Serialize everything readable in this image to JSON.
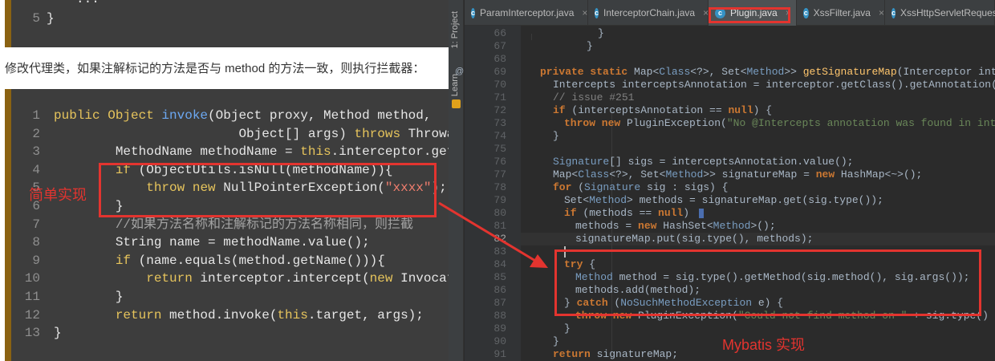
{
  "article": {
    "top_snippet": {
      "dots": "...",
      "line_number": "5",
      "closing": "}"
    },
    "paragraph": "修改代理类，如果注解标记的方法是否与 method 的方法一致，则执行拦截器：",
    "line_numbers": [
      "1",
      "2",
      "3",
      "4",
      "5",
      "6",
      "7",
      "8",
      "9",
      "10",
      "11",
      "12",
      "13"
    ],
    "code": {
      "l1_a": "public Object ",
      "l1_b": "invoke",
      "l1_c": "(Object proxy, Method method,",
      "l2_a": "                        Object[] args) ",
      "l2_b": "throws",
      "l2_c": " Throwabl",
      "l3_a": "        MethodName methodName = ",
      "l3_b": "this",
      "l3_c": ".interceptor.getCla",
      "l4_a": "        ",
      "l4_b": "if",
      "l4_c": " (ObjectUtils.isNull(methodName)){",
      "l5_a": "            ",
      "l5_b": "throw",
      "l5_c": " ",
      "l5_d": "new",
      "l5_e": " NullPointerException(",
      "l5_f": "\"xxxx\"",
      "l5_g": ");",
      "l6": "        }",
      "l7": "        //如果方法名称和注解标记的方法名称相同，则拦截",
      "l8": "        String name = methodName.value();",
      "l9_a": "        ",
      "l9_b": "if",
      "l9_c": " (name.equals(method.getName())){",
      "l10_a": "            ",
      "l10_b": "return",
      "l10_c": " interceptor.intercept(",
      "l10_d": "new",
      "l10_e": " Invocation",
      "l11": "        }",
      "l12_a": "        ",
      "l12_b": "return",
      "l12_c": " method.invoke(",
      "l12_d": "this",
      "l12_e": ".target, args);",
      "l13": "}"
    },
    "simple_impl_label": "简单实现"
  },
  "ide": {
    "side_tabs": {
      "project": "1: Project",
      "learn": "Learn"
    },
    "tabs": [
      {
        "label": "ParamInterceptor.java",
        "icon": "class-icon",
        "active": false
      },
      {
        "label": "InterceptorChain.java",
        "icon": "class-icon",
        "active": false
      },
      {
        "label": "Plugin.java",
        "icon": "class-icon",
        "active": true
      },
      {
        "label": "XssFilter.java",
        "icon": "class-icon",
        "active": false
      },
      {
        "label": "XssHttpServletRequestW",
        "icon": "class-icon",
        "active": false
      }
    ],
    "icon_letter": "c",
    "close_glyph": "×",
    "gutter_at": "@",
    "line_numbers": [
      "66",
      "67",
      "68",
      "69",
      "70",
      "71",
      "72",
      "73",
      "74",
      "75",
      "76",
      "77",
      "78",
      "79",
      "80",
      "81",
      "82",
      "83",
      "84",
      "85",
      "86",
      "87",
      "88",
      "89",
      "90",
      "91"
    ],
    "code": {
      "l69_a": "private static ",
      "l69_b": "Map",
      "l69_c": "<",
      "l69_d": "Class",
      "l69_e": "<?>",
      "l69_f": ", ",
      "l69_g": "Set",
      "l69_h": "<",
      "l69_i": "Method",
      "l69_j": ">> ",
      "l69_k": "getSignatureMap",
      "l69_l": "(Interceptor inter",
      "l70": "Intercepts interceptsAnnotation = interceptor.getClass().getAnnotation(In",
      "l71": "// issue #251",
      "l72_a": "if",
      "l72_b": " (interceptsAnnotation == ",
      "l72_c": "null",
      "l72_d": ") {",
      "l73_a": "throw new ",
      "l73_b": "PluginException(",
      "l73_c": "\"No @Intercepts annotation was found in inter",
      "l74": "}",
      "l76_a": "Signature",
      "l76_b": "[] sigs = interceptsAnnotation.value();",
      "l77_a": "Map",
      "l77_b": "<",
      "l77_c": "Class",
      "l77_d": "<?>",
      "l77_e": ", ",
      "l77_f": "Set",
      "l77_g": "<",
      "l77_h": "Method",
      "l77_i": ">> signatureMap = ",
      "l77_j": "new",
      "l77_k": " HashMap<~>();",
      "l78_a": "for",
      "l78_b": " (",
      "l78_c": "Signature",
      "l78_d": " sig : sigs) {",
      "l79_a": "Set",
      "l79_b": "<",
      "l79_c": "Method",
      "l79_d": "> methods = signatureMap.get(sig.type());",
      "l80_a": "if",
      "l80_b": " (methods == ",
      "l80_c": "null",
      "l80_d": ") ",
      "l81_a": "methods = ",
      "l81_b": "new",
      "l81_c": " HashSet<",
      "l81_d": "Method",
      "l81_e": ">();",
      "l82": "signatureMap.put(sig.type(), methods);",
      "l84_a": "try",
      "l84_b": " {",
      "l85_a": "Method",
      "l85_b": " method = sig.type().getMethod(sig.method(), sig.args());",
      "l86": "methods.add(method);",
      "l87_a": "} ",
      "l87_b": "catch",
      "l87_c": " (",
      "l87_d": "NoSuchMethodException",
      "l87_e": " e) {",
      "l88_a": "throw new ",
      "l88_b": "PluginException(",
      "l88_c": "\"Could not find method on \"",
      "l88_d": " + sig.type() + ",
      "l89": "}",
      "l90": "}",
      "l91_a": "return",
      "l91_b": " signatureMap;",
      "l92": "}"
    },
    "mybatis_label": "Mybatis 实现"
  },
  "colors": {
    "annotation_red": "#e3342f",
    "blog_code_bg": "#3d3d3d",
    "ide_bg": "#2b2b2b"
  }
}
